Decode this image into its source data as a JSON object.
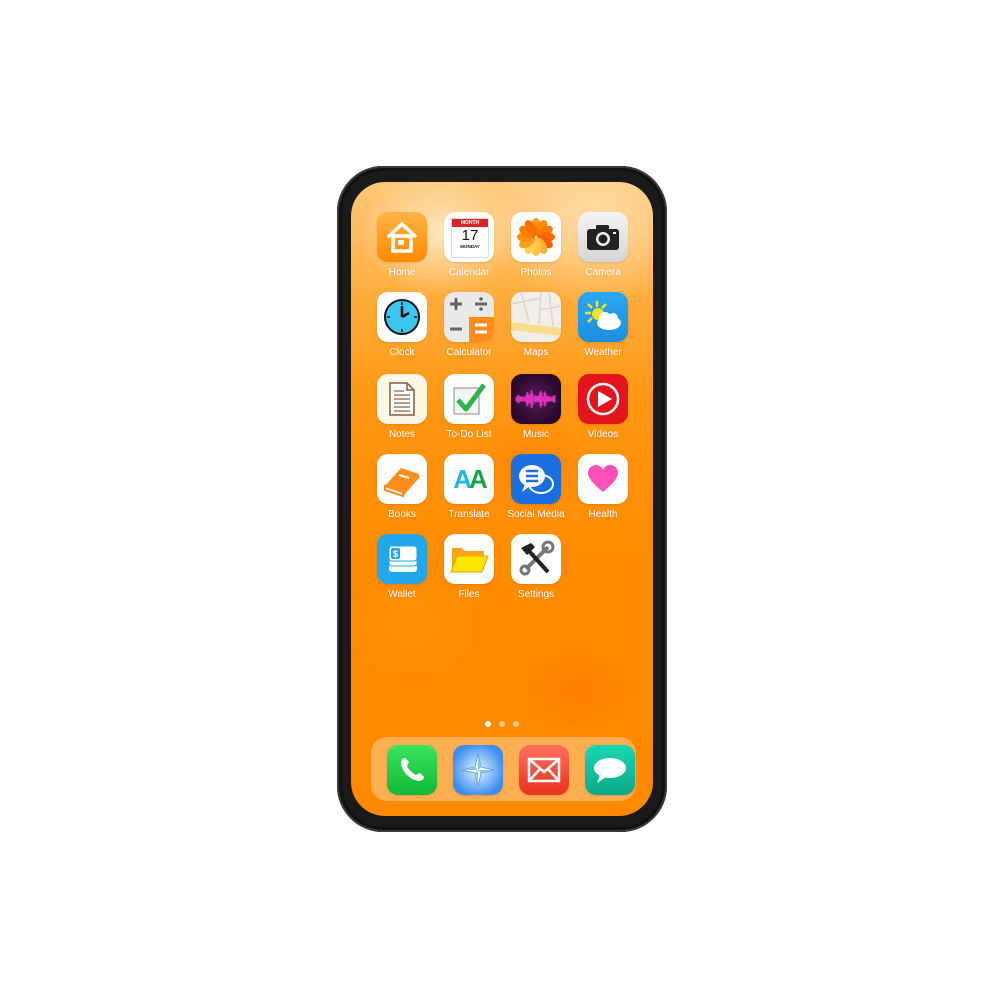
{
  "home_screen": {
    "apps": [
      {
        "label": "Home",
        "icon": "house-icon"
      },
      {
        "label": "Calendar",
        "icon": "calendar-icon",
        "month": "MONTH",
        "day": "17",
        "weekday": "MONDAY"
      },
      {
        "label": "Photos",
        "icon": "photos-flower-icon"
      },
      {
        "label": "Camera",
        "icon": "camera-icon"
      },
      {
        "label": "Clock",
        "icon": "clock-icon"
      },
      {
        "label": "Calculator",
        "icon": "calculator-icon"
      },
      {
        "label": "Maps",
        "icon": "map-icon"
      },
      {
        "label": "Weather",
        "icon": "sun-cloud-icon"
      },
      {
        "label": "Notes",
        "icon": "document-icon"
      },
      {
        "label": "To-Do List",
        "icon": "checkmark-icon"
      },
      {
        "label": "Music",
        "icon": "soundwave-icon"
      },
      {
        "label": "Videos",
        "icon": "play-icon"
      },
      {
        "label": "Books",
        "icon": "book-icon"
      },
      {
        "label": "Translate",
        "icon": "translate-aa-icon",
        "glyph": "AA"
      },
      {
        "label": "Social Media",
        "icon": "chat-bubbles-icon"
      },
      {
        "label": "Health",
        "icon": "heart-icon"
      },
      {
        "label": "Wallet",
        "icon": "wallet-cash-icon",
        "glyph": "$"
      },
      {
        "label": "Files",
        "icon": "folder-icon"
      },
      {
        "label": "Settings",
        "icon": "hammer-wrench-icon"
      }
    ],
    "page_indicator": {
      "pages": 3,
      "current": 1
    }
  },
  "dock": {
    "apps": [
      {
        "name": "Phone",
        "icon": "phone-icon"
      },
      {
        "name": "Safari",
        "icon": "compass-icon"
      },
      {
        "name": "Mail",
        "icon": "envelope-icon"
      },
      {
        "name": "Messages",
        "icon": "message-bubble-icon"
      }
    ]
  },
  "colors": {
    "wallpaper": "#ff8c00",
    "frame": "#1a1a1a",
    "label_text": "#ffffff"
  }
}
